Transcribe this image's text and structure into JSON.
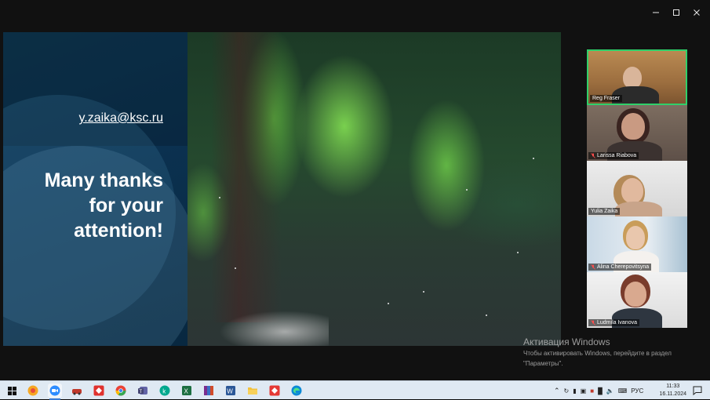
{
  "slide": {
    "email": "y.zaika@ksc.ru",
    "thanks_lines": [
      "Many thanks",
      "for your",
      "attention!"
    ]
  },
  "participants": [
    {
      "name": "Reg Fraser",
      "muted": false,
      "active": true
    },
    {
      "name": "Larissa Riabova",
      "muted": true,
      "active": false
    },
    {
      "name": "Yulia Zaika",
      "muted": false,
      "active": false
    },
    {
      "name": "Alina Cherepovitsyna",
      "muted": true,
      "active": false
    },
    {
      "name": "Ludmila Ivanova",
      "muted": true,
      "active": false
    }
  ],
  "activation": {
    "title": "Активация Windows",
    "line1": "Чтобы активировать Windows, перейдите в раздел",
    "line2": "\"Параметры\"."
  },
  "taskbar": {
    "apps": [
      "windows-start",
      "browser-yandex",
      "zoom",
      "app-red-car",
      "app-anydesk",
      "chrome",
      "teams",
      "kaspersky",
      "excel",
      "winrar",
      "word",
      "file-explorer",
      "app-red-2",
      "edge"
    ],
    "language": "РУС",
    "time": "11:33",
    "date": "16.11.2024"
  },
  "colors": {
    "active_border": "#2fd06a",
    "slide_bg": "#0b3150",
    "taskbar_bg": "#dfe9f3"
  }
}
